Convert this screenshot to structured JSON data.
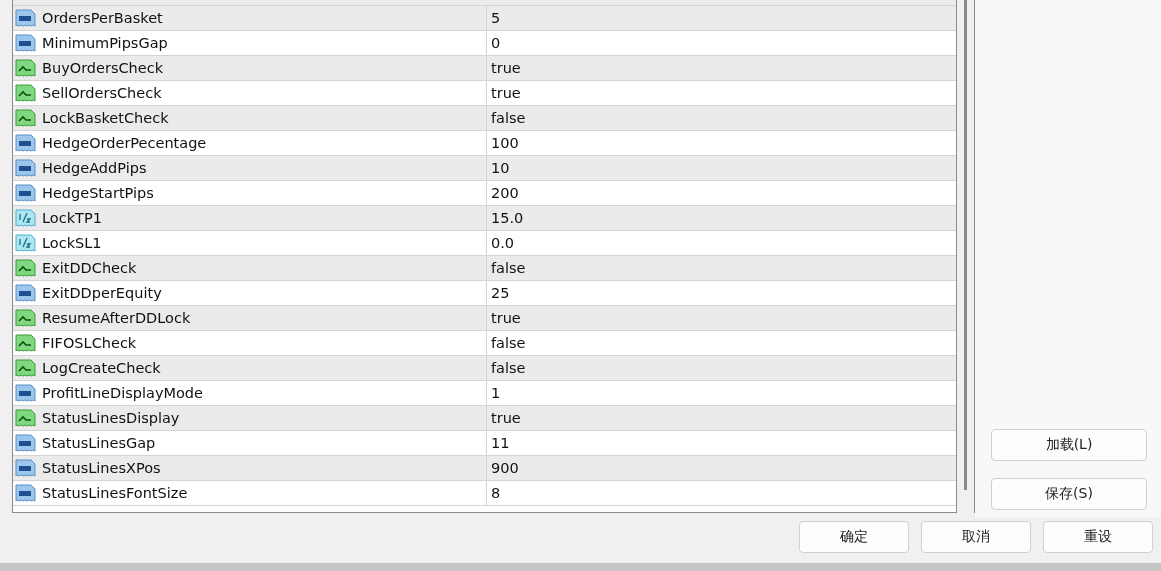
{
  "parameters": [
    {
      "name": "OrdersPerBasket",
      "value": "5",
      "kind": "int"
    },
    {
      "name": "MinimumPipsGap",
      "value": "0",
      "kind": "int"
    },
    {
      "name": "BuyOrdersCheck",
      "value": "true",
      "kind": "bool"
    },
    {
      "name": "SellOrdersCheck",
      "value": "true",
      "kind": "bool"
    },
    {
      "name": "LockBasketCheck",
      "value": "false",
      "kind": "bool"
    },
    {
      "name": "HedgeOrderPecentage",
      "value": "100",
      "kind": "int"
    },
    {
      "name": "HedgeAddPips",
      "value": "10",
      "kind": "int"
    },
    {
      "name": "HedgeStartPips",
      "value": "200",
      "kind": "int"
    },
    {
      "name": "LockTP1",
      "value": "15.0",
      "kind": "double"
    },
    {
      "name": "LockSL1",
      "value": "0.0",
      "kind": "double"
    },
    {
      "name": "ExitDDCheck",
      "value": "false",
      "kind": "bool"
    },
    {
      "name": "ExitDDperEquity",
      "value": "25",
      "kind": "int"
    },
    {
      "name": "ResumeAfterDDLock",
      "value": "true",
      "kind": "bool"
    },
    {
      "name": "FIFOSLCheck",
      "value": "false",
      "kind": "bool"
    },
    {
      "name": "LogCreateCheck",
      "value": "false",
      "kind": "bool"
    },
    {
      "name": "ProfitLineDisplayMode",
      "value": "1",
      "kind": "int"
    },
    {
      "name": "StatusLinesDisplay",
      "value": "true",
      "kind": "bool"
    },
    {
      "name": "StatusLinesGap",
      "value": "11",
      "kind": "int"
    },
    {
      "name": "StatusLinesXPos",
      "value": "900",
      "kind": "int"
    },
    {
      "name": "StatusLinesFontSize",
      "value": "8",
      "kind": "int"
    }
  ],
  "side_buttons": [
    "加载(L)",
    "保存(S)"
  ],
  "footer_buttons": [
    "确定",
    "取消",
    "重设"
  ]
}
